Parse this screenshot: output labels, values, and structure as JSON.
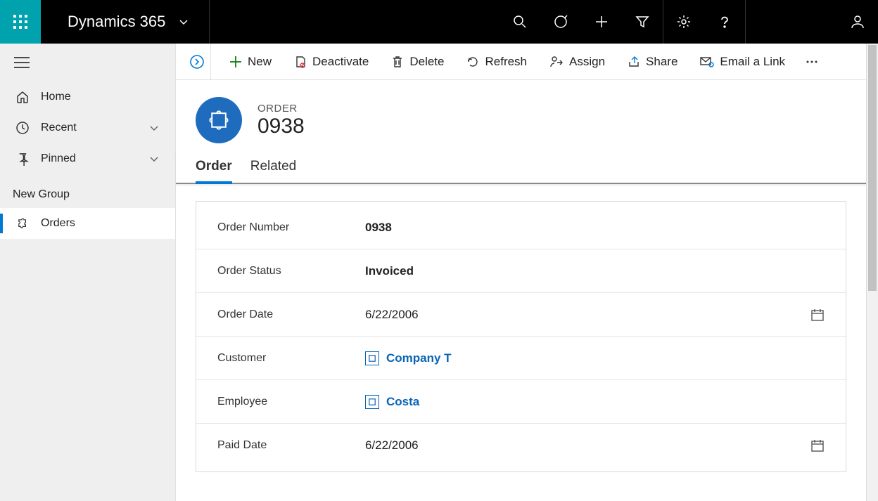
{
  "topbar": {
    "brand": "Dynamics 365"
  },
  "sidebar": {
    "home": "Home",
    "recent": "Recent",
    "pinned": "Pinned",
    "group_label": "New Group",
    "orders": "Orders"
  },
  "commandbar": {
    "new": "New",
    "deactivate": "Deactivate",
    "delete": "Delete",
    "refresh": "Refresh",
    "assign": "Assign",
    "share": "Share",
    "email_link": "Email a Link"
  },
  "record": {
    "entity": "ORDER",
    "name": "0938"
  },
  "tabs": {
    "order": "Order",
    "related": "Related"
  },
  "fields": {
    "order_number": {
      "label": "Order Number",
      "value": "0938"
    },
    "order_status": {
      "label": "Order Status",
      "value": "Invoiced"
    },
    "order_date": {
      "label": "Order Date",
      "value": "6/22/2006"
    },
    "customer": {
      "label": "Customer",
      "value": "Company T"
    },
    "employee": {
      "label": "Employee",
      "value": "Costa"
    },
    "paid_date": {
      "label": "Paid Date",
      "value": "6/22/2006"
    }
  }
}
